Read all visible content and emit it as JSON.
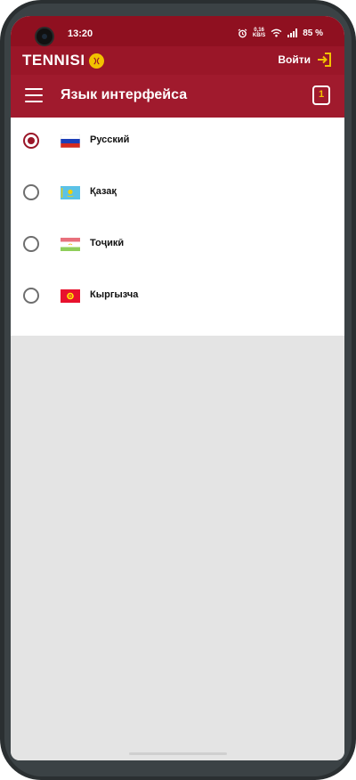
{
  "status_bar": {
    "time": "13:20",
    "speed_value": "0,16",
    "speed_unit": "KB/S",
    "battery": "85 %"
  },
  "brand_bar": {
    "logo_text": "TENNISI",
    "login_label": "Войти"
  },
  "toolbar": {
    "title": "Язык интерфейса",
    "coupon_count": "1"
  },
  "languages": [
    {
      "label": "Русский",
      "selected": true,
      "flag": "russia-flag"
    },
    {
      "label": "Қазақ",
      "selected": false,
      "flag": "kazakhstan-flag"
    },
    {
      "label": "Тоҷикӣ",
      "selected": false,
      "flag": "tajikistan-flag"
    },
    {
      "label": "Кыргызча",
      "selected": false,
      "flag": "kyrgyzstan-flag"
    }
  ],
  "colors": {
    "brand": "#9a1628",
    "accent": "#f2c200",
    "background": "#e4e4e4"
  }
}
